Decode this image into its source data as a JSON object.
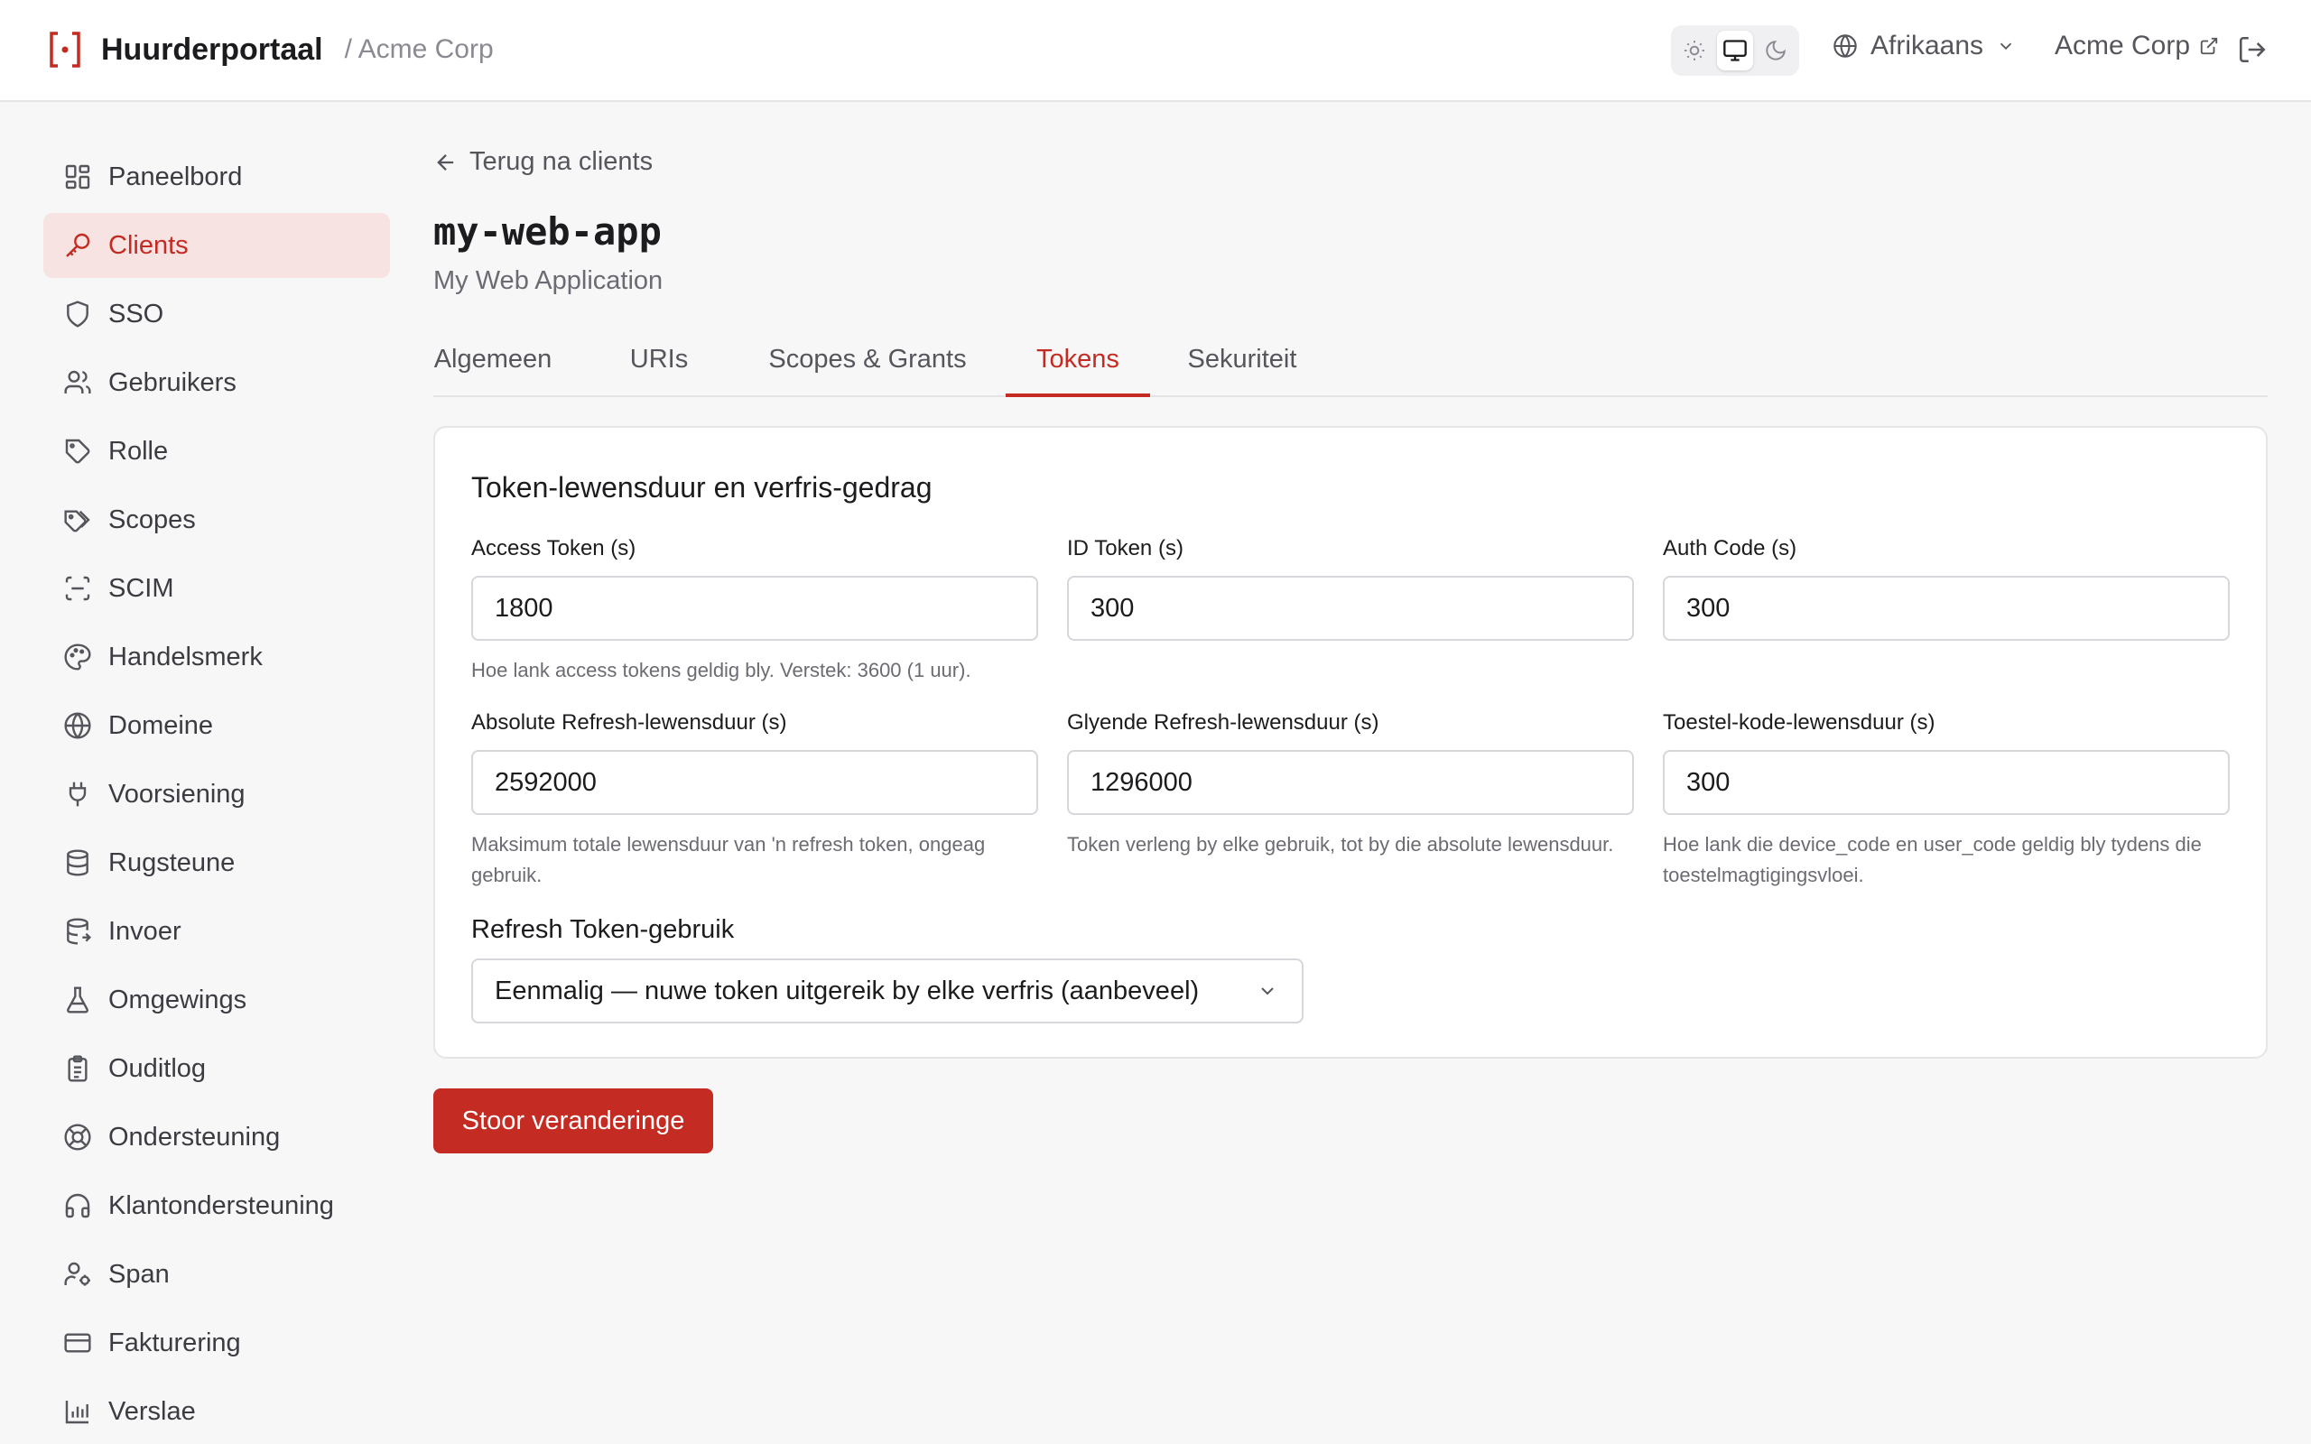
{
  "header": {
    "app_name": "Huurderportaal",
    "breadcrumb_tenant": "/ Acme Corp",
    "theme_options": [
      "sun-icon",
      "monitor-icon",
      "moon-icon"
    ],
    "language": "Afrikaans",
    "tenant_link": "Acme Corp"
  },
  "sidebar": {
    "items": [
      {
        "label": "Paneelbord",
        "icon": "dashboard-icon"
      },
      {
        "label": "Clients",
        "icon": "key-icon",
        "active": true
      },
      {
        "label": "SSO",
        "icon": "shield-icon"
      },
      {
        "label": "Gebruikers",
        "icon": "users-icon"
      },
      {
        "label": "Rolle",
        "icon": "tag-icon"
      },
      {
        "label": "Scopes",
        "icon": "tags-icon"
      },
      {
        "label": "SCIM",
        "icon": "scan-icon"
      },
      {
        "label": "Handelsmerk",
        "icon": "palette-icon"
      },
      {
        "label": "Domeine",
        "icon": "globe-icon"
      },
      {
        "label": "Voorsiening",
        "icon": "plug-icon"
      },
      {
        "label": "Rugsteune",
        "icon": "database-icon"
      },
      {
        "label": "Invoer",
        "icon": "database-import-icon"
      },
      {
        "label": "Omgewings",
        "icon": "flask-icon"
      },
      {
        "label": "Ouditlog",
        "icon": "clipboard-icon"
      },
      {
        "label": "Ondersteuning",
        "icon": "lifebuoy-icon"
      },
      {
        "label": "Klantondersteuning",
        "icon": "headphones-icon"
      },
      {
        "label": "Span",
        "icon": "user-cog-icon"
      },
      {
        "label": "Fakturering",
        "icon": "credit-card-icon"
      },
      {
        "label": "Verslae",
        "icon": "bar-chart-icon"
      }
    ]
  },
  "main": {
    "back_label": "Terug na clients",
    "client_id": "my-web-app",
    "client_name": "My Web Application",
    "tabs": [
      {
        "label": "Algemeen"
      },
      {
        "label": "URIs"
      },
      {
        "label": "Scopes & Grants"
      },
      {
        "label": "Tokens",
        "active": true
      },
      {
        "label": "Sekuriteit"
      }
    ],
    "card": {
      "title": "Token-lewensduur en verfris-gedrag",
      "fields": [
        {
          "label": "Access Token (s)",
          "value": "1800",
          "help": "Hoe lank access tokens geldig bly. Verstek: 3600 (1 uur)."
        },
        {
          "label": "ID Token (s)",
          "value": "300",
          "help": ""
        },
        {
          "label": "Auth Code (s)",
          "value": "300",
          "help": ""
        },
        {
          "label": "Absolute Refresh-lewensduur (s)",
          "value": "2592000",
          "help": "Maksimum totale lewensduur van 'n refresh token, ongeag gebruik."
        },
        {
          "label": "Glyende Refresh-lewensduur (s)",
          "value": "1296000",
          "help": "Token verleng by elke gebruik, tot by die absolute lewensduur."
        },
        {
          "label": "Toestel-kode-lewensduur (s)",
          "value": "300",
          "help": "Hoe lank die device_code en user_code geldig bly tydens die toestelmagtigingsvloei."
        }
      ],
      "refresh_usage_label": "Refresh Token-gebruik",
      "refresh_usage_value": "Eenmalig — nuwe token uitgereik by elke verfris (aanbeveel)"
    },
    "save_label": "Stoor veranderinge"
  },
  "colors": {
    "accent": "#c42b23",
    "active_nav_bg": "#f7e3e2",
    "page_bg": "#f7f7f8"
  }
}
